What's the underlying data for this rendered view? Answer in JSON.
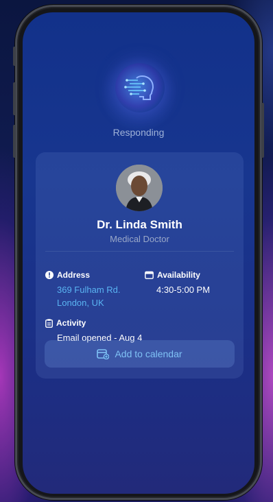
{
  "status_text": "Responding",
  "contact": {
    "name": "Dr. Linda Smith",
    "title": "Medical Doctor"
  },
  "address": {
    "label": "Address",
    "line1": "369 Fulham Rd.",
    "line2": "London, UK"
  },
  "availability": {
    "label": "Availability",
    "value": "4:30-5:00 PM"
  },
  "activity": {
    "label": "Activity",
    "value": "Email opened - Aug 4"
  },
  "action": {
    "label": "Add to calendar"
  },
  "colors": {
    "accent_link": "#5ab4f2",
    "button_text": "#7fc2f5",
    "screen_bg": "#18368f"
  },
  "icons": {
    "logo": "ai-head-circuit-icon",
    "address": "info-circle-icon",
    "availability": "calendar-icon",
    "activity": "clipboard-icon",
    "action": "calendar-add-icon"
  }
}
